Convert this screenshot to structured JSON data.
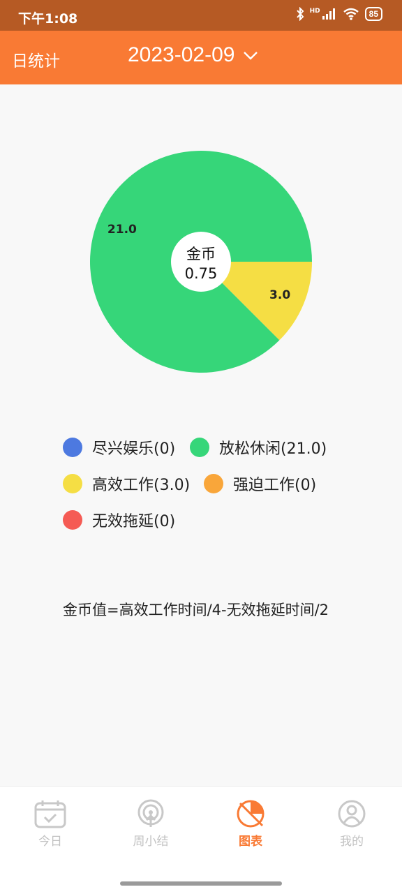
{
  "status_bar": {
    "time": "下午1:08",
    "network": "HD",
    "battery": "85"
  },
  "header": {
    "title": "日统计",
    "date": "2023-02-09",
    "accent_color": "#f97a34"
  },
  "chart": {
    "center_label": "金币",
    "center_value": "0.75"
  },
  "chart_data": {
    "type": "pie",
    "categories": [
      "尽兴娱乐",
      "放松休闲",
      "高效工作",
      "强迫工作",
      "无效拖延"
    ],
    "values": [
      0,
      21.0,
      3.0,
      0,
      0
    ],
    "data_labels": [
      "",
      "21.0",
      "3.0",
      "",
      ""
    ],
    "colors": [
      "#4d79e0",
      "#36d679",
      "#f5de44",
      "#f9a63a",
      "#f55b54"
    ]
  },
  "legend": [
    {
      "label": "尽兴娱乐(0)",
      "color": "#4d79e0"
    },
    {
      "label": "放松休闲(21.0)",
      "color": "#36d679"
    },
    {
      "label": "高效工作(3.0)",
      "color": "#f5de44"
    },
    {
      "label": "强迫工作(0)",
      "color": "#f9a63a"
    },
    {
      "label": "无效拖延(0)",
      "color": "#f55b54"
    }
  ],
  "formula": "金币值=高效工作时间/4-无效拖延时间/2",
  "tabs": [
    {
      "label": "今日",
      "icon": "calendar-check-icon",
      "active": false
    },
    {
      "label": "周小结",
      "icon": "broadcast-icon",
      "active": false
    },
    {
      "label": "图表",
      "icon": "chart-icon",
      "active": true
    },
    {
      "label": "我的",
      "icon": "user-icon",
      "active": false
    }
  ]
}
